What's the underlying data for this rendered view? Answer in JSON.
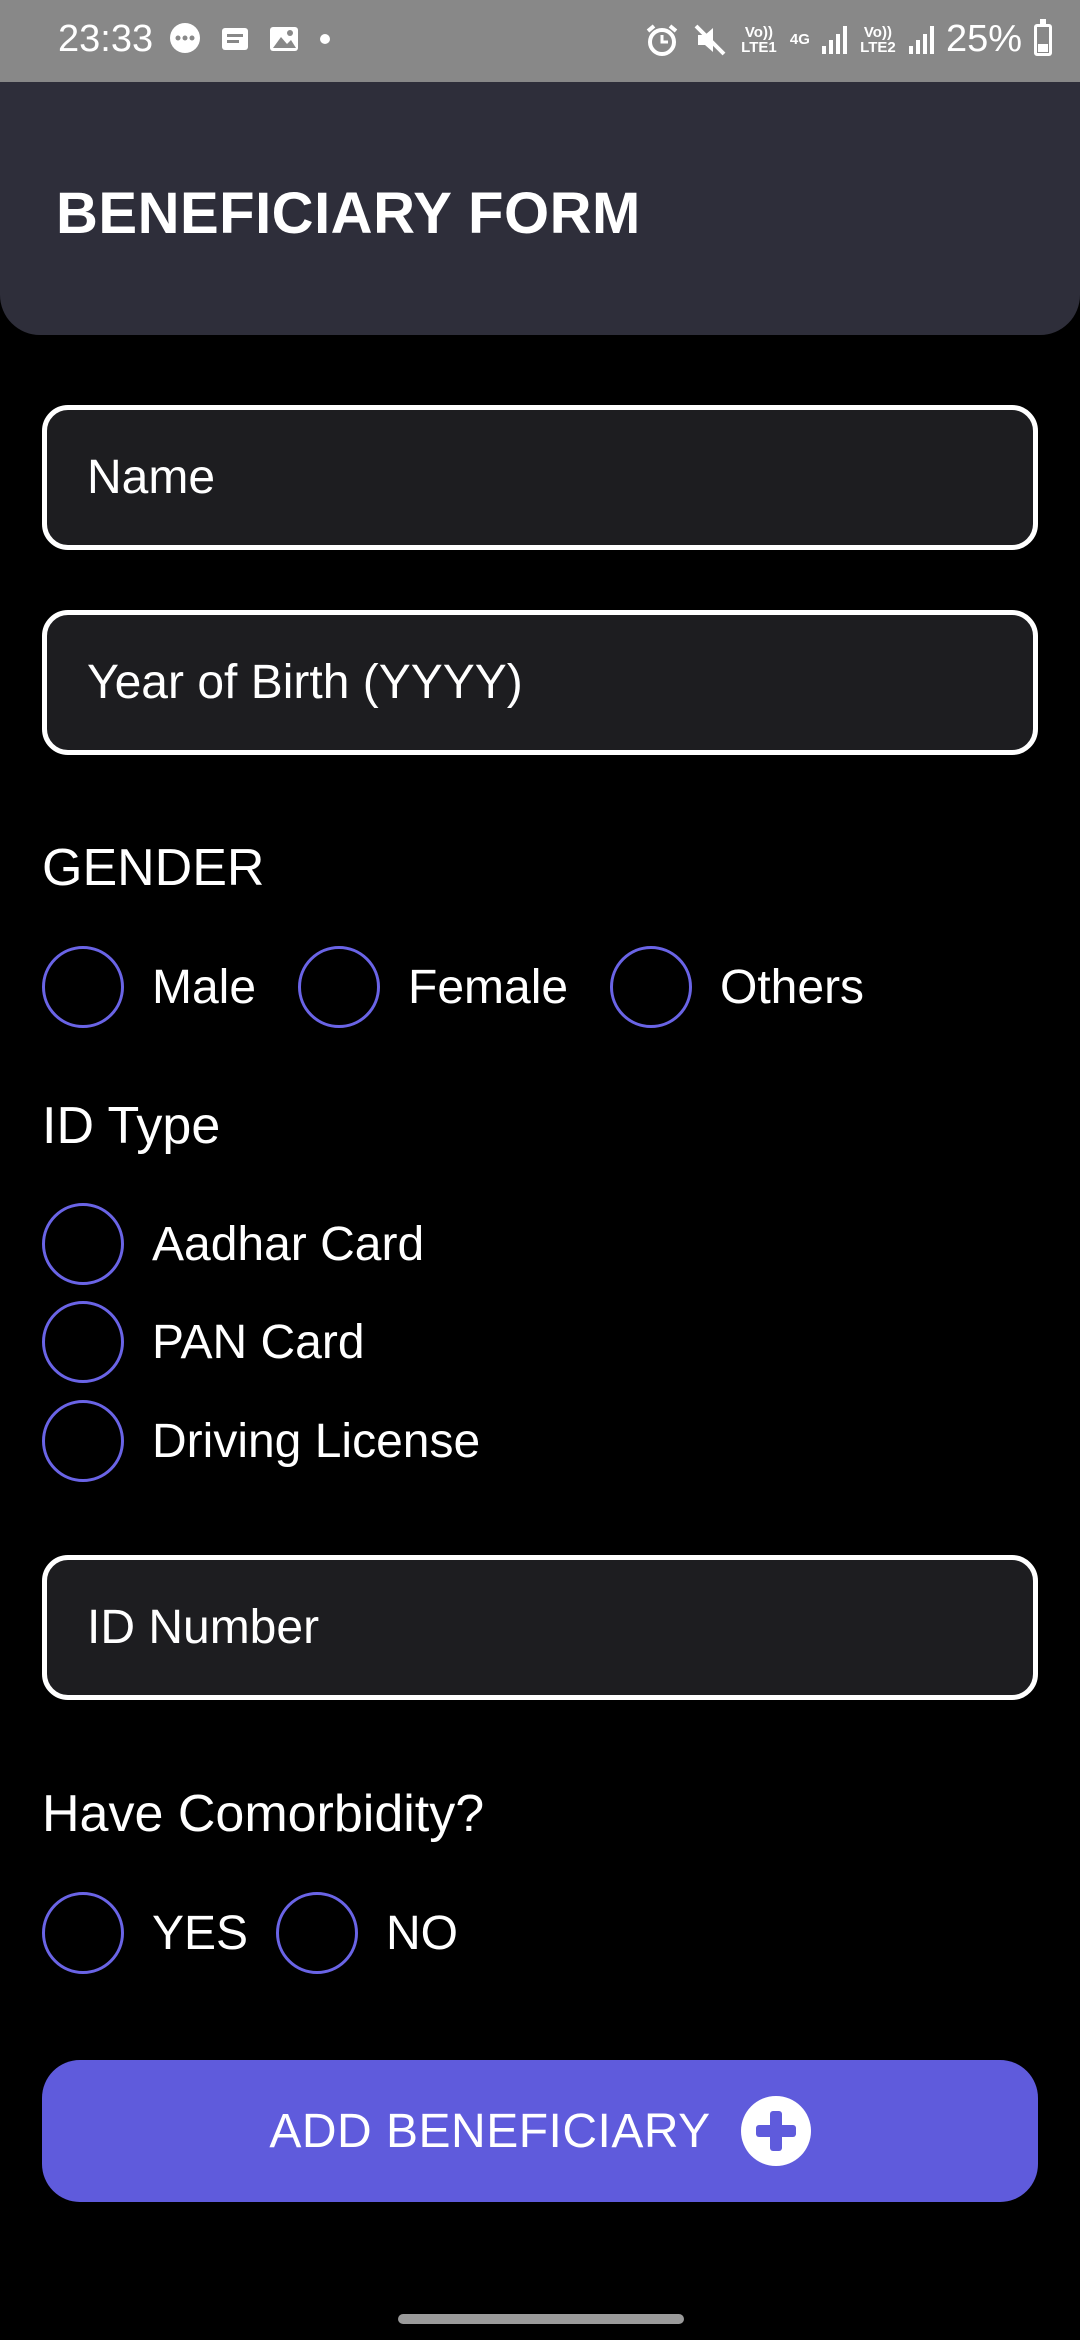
{
  "status_bar": {
    "time": "23:33",
    "left_icons": [
      "chat-icon",
      "message-icon",
      "gallery-icon",
      "dot-icon"
    ],
    "sim1": "Vo)) LTE1",
    "network": "4G",
    "sim2": "Vo)) LTE2",
    "battery_percent": "25%"
  },
  "header": {
    "title": "BENEFICIARY FORM"
  },
  "form": {
    "name_placeholder": "Name",
    "yob_placeholder": "Year of Birth (YYYY)",
    "gender": {
      "label": "GENDER",
      "options": [
        "Male",
        "Female",
        "Others"
      ]
    },
    "id_type": {
      "label": "ID Type",
      "options": [
        "Aadhar Card",
        "PAN Card",
        "Driving License"
      ]
    },
    "id_number_placeholder": "ID Number",
    "comorbidity": {
      "label": "Have Comorbidity?",
      "options": [
        "YES",
        "NO"
      ]
    },
    "submit_label": "ADD BENEFICIARY"
  },
  "colors": {
    "accent": "#5f5bdc",
    "radio_border": "#6a64e6",
    "header_bg": "#2e2e3a",
    "input_bg": "#1d1d20"
  }
}
